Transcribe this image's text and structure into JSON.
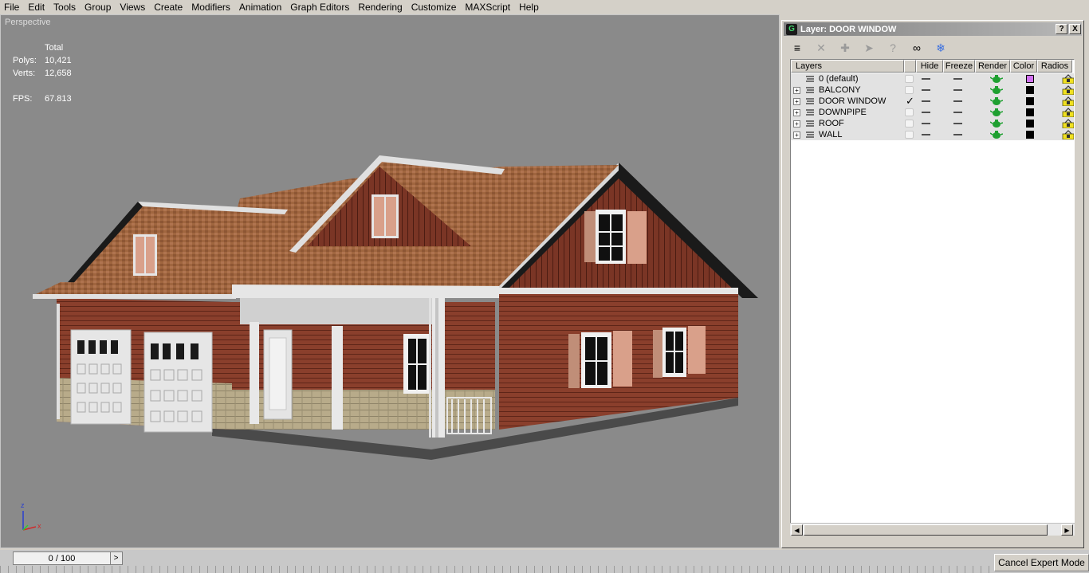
{
  "menu": [
    "File",
    "Edit",
    "Tools",
    "Group",
    "Views",
    "Create",
    "Modifiers",
    "Animation",
    "Graph Editors",
    "Rendering",
    "Customize",
    "MAXScript",
    "Help"
  ],
  "viewport": {
    "label": "Perspective",
    "stats_header": "Total",
    "polys_label": "Polys:",
    "polys_value": "10,421",
    "verts_label": "Verts:",
    "verts_value": "12,658",
    "fps_label": "FPS:",
    "fps_value": "67.813",
    "gizmo_z": "z",
    "gizmo_x": "x"
  },
  "layer_window": {
    "title": "Layer: DOOR WINDOW",
    "help_button": "?",
    "close_button": "X",
    "toolbar_icons": [
      "layers-icon",
      "delete-icon",
      "add-icon",
      "select-icon",
      "highlight-icon",
      "hide-all-icon",
      "freeze-all-icon"
    ],
    "columns": {
      "layers": "Layers",
      "hide": "Hide",
      "freeze": "Freeze",
      "render": "Render",
      "color": "Color",
      "radiosity": "Radios"
    },
    "rows": [
      {
        "name": "0 (default)",
        "expandable": false,
        "current": false,
        "color": "#d070f0"
      },
      {
        "name": "BALCONY",
        "expandable": true,
        "current": false,
        "color": "#000000"
      },
      {
        "name": "DOOR WINDOW",
        "expandable": true,
        "current": true,
        "color": "#000000"
      },
      {
        "name": "DOWNPIPE",
        "expandable": true,
        "current": false,
        "color": "#000000"
      },
      {
        "name": "ROOF",
        "expandable": true,
        "current": false,
        "color": "#000000"
      },
      {
        "name": "WALL",
        "expandable": true,
        "current": false,
        "color": "#000000"
      }
    ]
  },
  "timeline": {
    "frame": "0 / 100",
    "next": ">"
  },
  "status": {
    "cancel_expert_mode": "Cancel Expert Mode"
  }
}
